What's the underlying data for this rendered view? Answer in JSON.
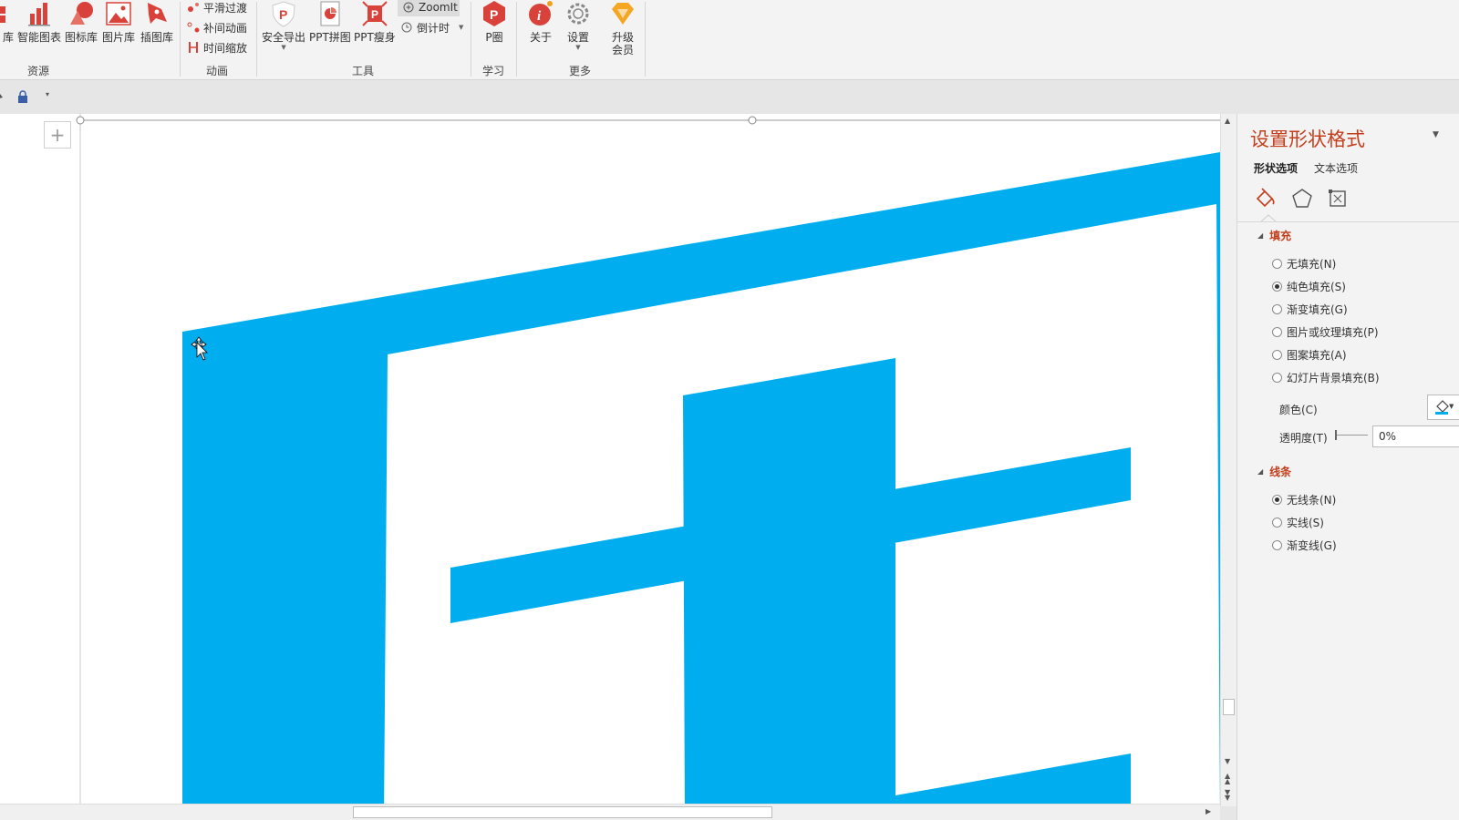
{
  "ribbon": {
    "resources": {
      "group_label": "资源",
      "items": [
        {
          "label": "库"
        },
        {
          "label": "智能图表"
        },
        {
          "label": "图标库"
        },
        {
          "label": "图片库"
        },
        {
          "label": "插图库"
        }
      ]
    },
    "animation": {
      "group_label": "动画",
      "items": [
        {
          "label": "平滑过渡"
        },
        {
          "label": "补间动画"
        },
        {
          "label": "时间缩放"
        }
      ]
    },
    "tools": {
      "group_label": "工具",
      "items": [
        {
          "label": "安全导出"
        },
        {
          "label": "PPT拼图"
        },
        {
          "label": "PPT瘦身"
        }
      ],
      "zoomit_label": "ZoomIt",
      "countdown_label": "倒计时"
    },
    "learn": {
      "group_label": "学习",
      "items": [
        {
          "label": "P圈"
        }
      ]
    },
    "more": {
      "group_label": "更多",
      "items": [
        {
          "label": "关于"
        },
        {
          "label": "设置"
        },
        {
          "label": "升级\n会员"
        }
      ]
    }
  },
  "colors": {
    "accent": "#c43e1c",
    "shape_fill": "#00aeef",
    "ribbon_red": "#d9423a"
  },
  "format_pane": {
    "title": "设置形状格式",
    "tabs": [
      "形状选项",
      "文本选项"
    ],
    "fill_section": {
      "header": "填充",
      "options": [
        {
          "label": "无填充(N)",
          "selected": false
        },
        {
          "label": "纯色填充(S)",
          "selected": true
        },
        {
          "label": "渐变填充(G)",
          "selected": false
        },
        {
          "label": "图片或纹理填充(P)",
          "selected": false
        },
        {
          "label": "图案填充(A)",
          "selected": false
        },
        {
          "label": "幻灯片背景填充(B)",
          "selected": false
        }
      ],
      "color_label": "颜色(C)",
      "transparency_label": "透明度(T)",
      "transparency_value": "0%"
    },
    "line_section": {
      "header": "线条",
      "options": [
        {
          "label": "无线条(N)",
          "selected": true
        },
        {
          "label": "实线(S)",
          "selected": false
        },
        {
          "label": "渐变线(G)",
          "selected": false
        }
      ]
    }
  }
}
